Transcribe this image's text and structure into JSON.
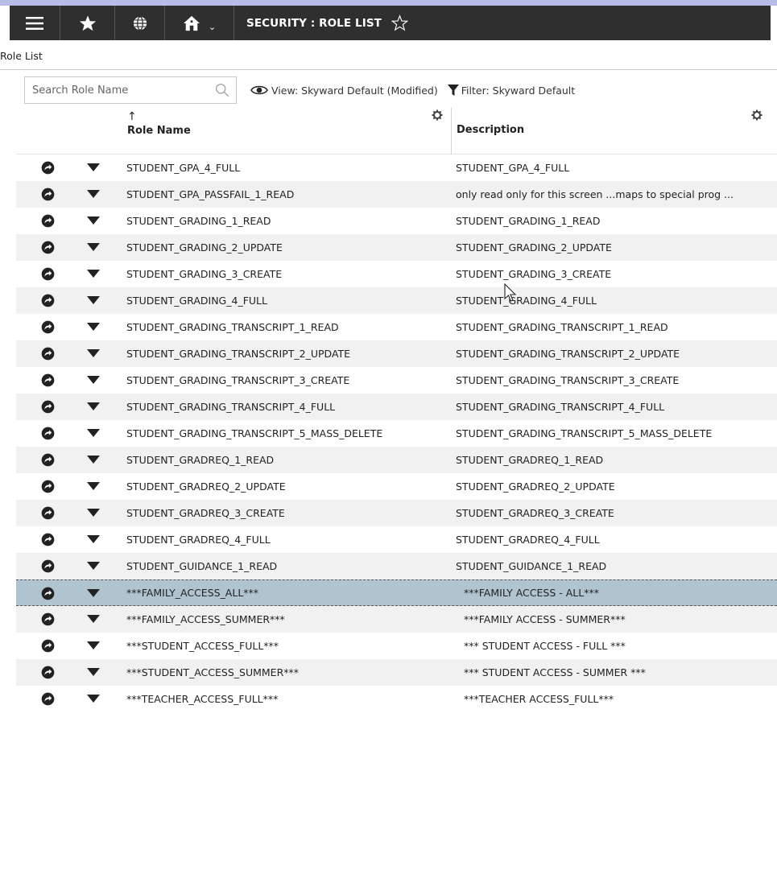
{
  "toolbar": {
    "title": "SECURITY : ROLE LIST"
  },
  "breadcrumb": "Role List",
  "filters": {
    "search_placeholder": "Search Role Name",
    "view_label": "View: Skyward Default (Modified)",
    "filter_label": "Filter: Skyward Default"
  },
  "grid": {
    "columns": {
      "role_name": "Role Name",
      "description": "Description",
      "sort_indicator": "↑"
    },
    "rows": [
      {
        "name": "STUDENT_GPA_4_FULL",
        "description": "STUDENT_GPA_4_FULL"
      },
      {
        "name": "STUDENT_GPA_PASSFAIL_1_READ",
        "description": "only read only for this screen ...maps to special prog ..."
      },
      {
        "name": "STUDENT_GRADING_1_READ",
        "description": "STUDENT_GRADING_1_READ"
      },
      {
        "name": "STUDENT_GRADING_2_UPDATE",
        "description": "STUDENT_GRADING_2_UPDATE"
      },
      {
        "name": "STUDENT_GRADING_3_CREATE",
        "description": "STUDENT_GRADING_3_CREATE"
      },
      {
        "name": "STUDENT_GRADING_4_FULL",
        "description": "STUDENT_GRADING_4_FULL"
      },
      {
        "name": "STUDENT_GRADING_TRANSCRIPT_1_READ",
        "description": "STUDENT_GRADING_TRANSCRIPT_1_READ"
      },
      {
        "name": "STUDENT_GRADING_TRANSCRIPT_2_UPDATE",
        "description": "STUDENT_GRADING_TRANSCRIPT_2_UPDATE"
      },
      {
        "name": "STUDENT_GRADING_TRANSCRIPT_3_CREATE",
        "description": "STUDENT_GRADING_TRANSCRIPT_3_CREATE"
      },
      {
        "name": "STUDENT_GRADING_TRANSCRIPT_4_FULL",
        "description": "STUDENT_GRADING_TRANSCRIPT_4_FULL"
      },
      {
        "name": "STUDENT_GRADING_TRANSCRIPT_5_MASS_DELETE",
        "description": "STUDENT_GRADING_TRANSCRIPT_5_MASS_DELETE"
      },
      {
        "name": "STUDENT_GRADREQ_1_READ",
        "description": "STUDENT_GRADREQ_1_READ"
      },
      {
        "name": "STUDENT_GRADREQ_2_UPDATE",
        "description": "STUDENT_GRADREQ_2_UPDATE"
      },
      {
        "name": "STUDENT_GRADREQ_3_CREATE",
        "description": "STUDENT_GRADREQ_3_CREATE"
      },
      {
        "name": "STUDENT_GRADREQ_4_FULL",
        "description": "STUDENT_GRADREQ_4_FULL"
      },
      {
        "name": "STUDENT_GUIDANCE_1_READ",
        "description": "STUDENT_GUIDANCE_1_READ"
      },
      {
        "name": "***FAMILY_ACCESS_ALL***",
        "description": "***FAMILY ACCESS - ALL***"
      },
      {
        "name": "***FAMILY_ACCESS_SUMMER***",
        "description": "***FAMILY ACCESS - SUMMER***"
      },
      {
        "name": "***STUDENT_ACCESS_FULL***",
        "description": "*** STUDENT ACCESS - FULL ***"
      },
      {
        "name": "***STUDENT_ACCESS_SUMMER***",
        "description": "*** STUDENT ACCESS - SUMMER ***"
      },
      {
        "name": "***TEACHER_ACCESS_FULL***",
        "description": "***TEACHER ACCESS_FULL***"
      }
    ],
    "selected_index": 16
  },
  "colors": {
    "toolbar_bg": "#2f2f2f",
    "selected_row": "#b0c4cf",
    "stripe": "#f1f1f1"
  },
  "icons": [
    "menu-icon",
    "star-icon",
    "globe-icon",
    "home-icon",
    "chevron-down-icon",
    "favorite-star-outline-icon",
    "search-icon",
    "eye-icon",
    "filter-icon",
    "gear-icon",
    "row-action-icon",
    "row-dropdown-icon",
    "mouse-cursor-icon"
  ]
}
